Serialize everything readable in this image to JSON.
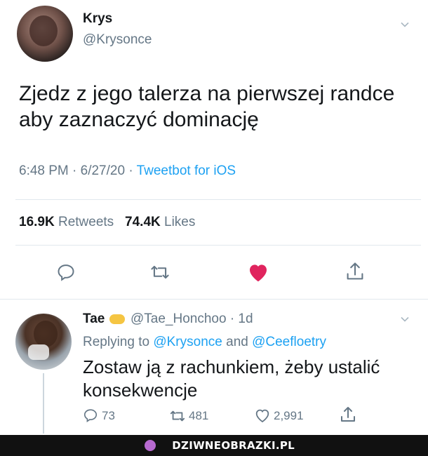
{
  "tweet": {
    "author_name": "Krys",
    "author_handle": "@Krysonce",
    "text": "Zjedz z jego talerza na pierwszej randce aby zaznaczyć dominację",
    "time": "6:48 PM · 6/27/20 · ",
    "source": "Tweetbot for iOS",
    "retweets_count": "16.9K",
    "retweets_label": " Retweets",
    "likes_count": "74.4K",
    "likes_label": " Likes"
  },
  "reply": {
    "author_name": "Tae",
    "author_handle": "@Tae_Honchoo · 1d",
    "replying_prefix": "Replying to ",
    "mention1": "@Krysonce",
    "and": " and ",
    "mention2": "@Ceefloetry",
    "text": "Zostaw ją z rachunkiem, żeby ustalić konsekwencje",
    "reply_count": "73",
    "retweet_count": "481",
    "like_count": "2,991"
  },
  "watermark": "DZIWNEOBRAZKI.PL",
  "colors": {
    "accent": "#1da1f2",
    "like": "#e0245e",
    "muted": "#657786"
  },
  "icons": [
    "chevron-down-icon",
    "reply-icon",
    "retweet-icon",
    "heart-icon",
    "share-icon",
    "emoji-handshake-icon"
  ]
}
